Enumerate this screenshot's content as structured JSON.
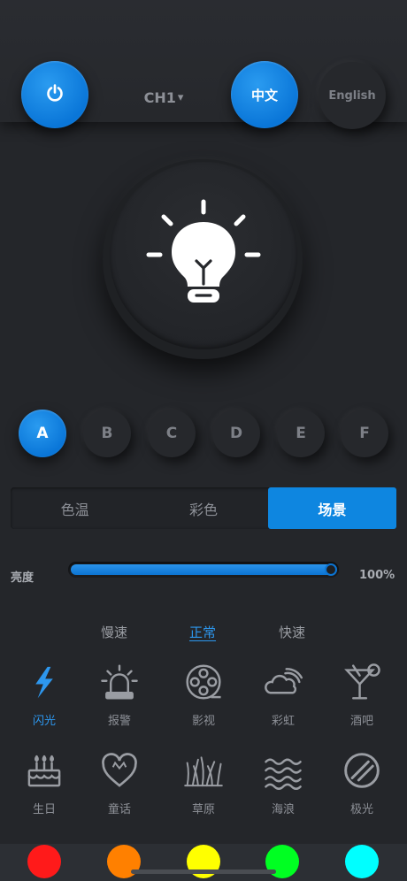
{
  "header": {
    "channel_label": "CH1",
    "channel_chevron": "▾",
    "lang_zh_label": "中文",
    "lang_en_label": "English",
    "power_icon": "power-icon"
  },
  "main_light": {
    "icon": "lightbulb-icon"
  },
  "groups": [
    {
      "label": "A",
      "active": true
    },
    {
      "label": "B",
      "active": false
    },
    {
      "label": "C",
      "active": false
    },
    {
      "label": "D",
      "active": false
    },
    {
      "label": "E",
      "active": false
    },
    {
      "label": "F",
      "active": false
    }
  ],
  "mode_tabs": [
    {
      "label": "色温",
      "active": false
    },
    {
      "label": "彩色",
      "active": false
    },
    {
      "label": "场景",
      "active": true
    }
  ],
  "brightness": {
    "label": "亮度",
    "value_text": "100%",
    "level": 1.0
  },
  "speeds": [
    {
      "label": "慢速",
      "active": false
    },
    {
      "label": "正常",
      "active": true
    },
    {
      "label": "快速",
      "active": false
    }
  ],
  "scenes": [
    {
      "label": "闪光",
      "icon": "lightning-icon",
      "active": true
    },
    {
      "label": "报警",
      "icon": "alarm-siren-icon",
      "active": false
    },
    {
      "label": "影视",
      "icon": "film-reel-icon",
      "active": false
    },
    {
      "label": "彩虹",
      "icon": "rainbow-cloud-icon",
      "active": false
    },
    {
      "label": "酒吧",
      "icon": "cocktail-icon",
      "active": false
    },
    {
      "label": "生日",
      "icon": "birthday-cake-icon",
      "active": false
    },
    {
      "label": "童话",
      "icon": "heart-icon",
      "active": false
    },
    {
      "label": "草原",
      "icon": "grass-icon",
      "active": false
    },
    {
      "label": "海浪",
      "icon": "waves-icon",
      "active": false
    },
    {
      "label": "极光",
      "icon": "aurora-icon",
      "active": false
    }
  ],
  "palette": [
    "#ff1a1a",
    "#ff8000",
    "#ffff00",
    "#00ff22",
    "#00ffff"
  ],
  "colors": {
    "accent": "#0e86e0",
    "background": "#24262a"
  }
}
